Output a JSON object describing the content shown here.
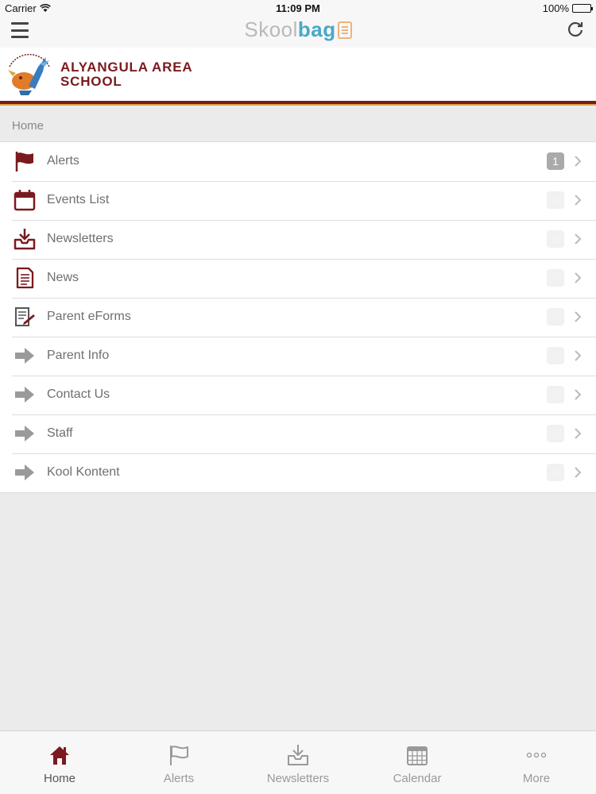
{
  "status_bar": {
    "carrier": "Carrier",
    "time": "11:09 PM",
    "battery": "100%"
  },
  "nav_bar": {
    "logo_part1": "Skool",
    "logo_part2": "bag"
  },
  "school": {
    "name_line1": "ALYANGULA AREA",
    "name_line2": "SCHOOL"
  },
  "breadcrumb": "Home",
  "menu": {
    "items": [
      {
        "label": "Alerts",
        "badge": "1",
        "icon": "flag-icon",
        "active": true
      },
      {
        "label": "Events List",
        "badge": "0",
        "icon": "calendar-icon",
        "active": false
      },
      {
        "label": "Newsletters",
        "badge": "0",
        "icon": "inbox-download-icon",
        "active": false
      },
      {
        "label": "News",
        "badge": "0",
        "icon": "document-icon",
        "active": false
      },
      {
        "label": "Parent eForms",
        "badge": "0",
        "icon": "form-pen-icon",
        "active": false
      },
      {
        "label": "Parent Info",
        "badge": "0",
        "icon": "arrow-right-icon",
        "active": false
      },
      {
        "label": "Contact Us",
        "badge": "0",
        "icon": "arrow-right-icon",
        "active": false
      },
      {
        "label": "Staff",
        "badge": "0",
        "icon": "arrow-right-icon",
        "active": false
      },
      {
        "label": "Kool Kontent",
        "badge": "0",
        "icon": "arrow-right-icon",
        "active": false
      }
    ]
  },
  "tab_bar": {
    "tabs": [
      {
        "label": "Home",
        "icon": "home-icon",
        "selected": true
      },
      {
        "label": "Alerts",
        "icon": "flag-icon",
        "selected": false
      },
      {
        "label": "Newsletters",
        "icon": "inbox-download-icon",
        "selected": false
      },
      {
        "label": "Calendar",
        "icon": "calendar-grid-icon",
        "selected": false
      },
      {
        "label": "More",
        "icon": "more-dots-icon",
        "selected": false
      }
    ]
  },
  "colors": {
    "brand": "#7a1a1f",
    "accent_gold": "#d9a441",
    "logo_blue": "#47a9c6"
  }
}
